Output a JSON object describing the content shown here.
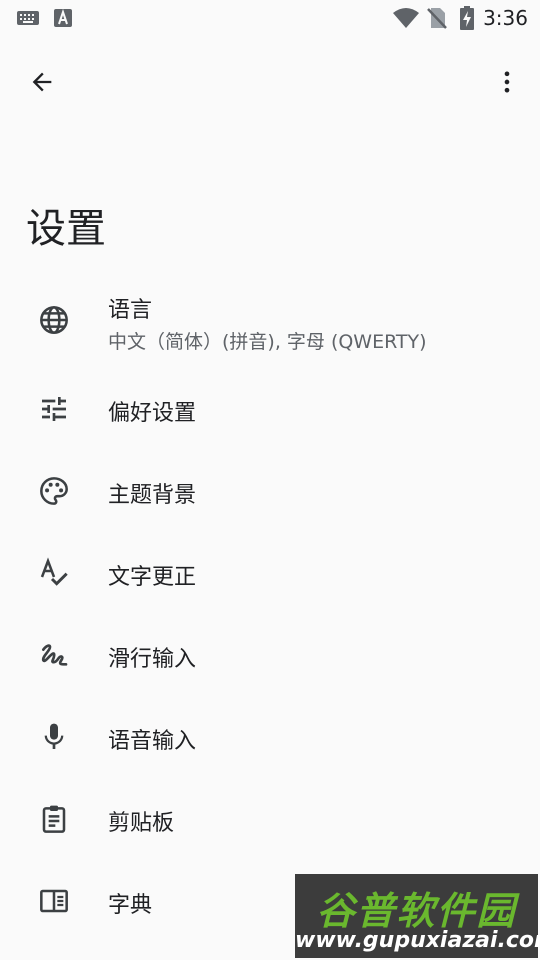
{
  "status_bar": {
    "time": "3:36",
    "icons": [
      "keyboard-icon",
      "font-a-icon",
      "wifi-icon",
      "no-sim-icon",
      "battery-charging-icon"
    ]
  },
  "toolbar": {
    "back_icon": "arrow-back-icon",
    "more_icon": "more-vert-icon"
  },
  "page": {
    "title": "设置"
  },
  "menu": [
    {
      "icon": "globe-icon",
      "label": "语言",
      "sub": "中文（简体）(拼音), 字母 (QWERTY)"
    },
    {
      "icon": "tune-icon",
      "label": "偏好设置"
    },
    {
      "icon": "palette-icon",
      "label": "主题背景"
    },
    {
      "icon": "spellcheck-icon",
      "label": "文字更正"
    },
    {
      "icon": "gesture-icon",
      "label": "滑行输入"
    },
    {
      "icon": "mic-icon",
      "label": "语音输入"
    },
    {
      "icon": "clipboard-icon",
      "label": "剪贴板"
    },
    {
      "icon": "dictionary-icon",
      "label": "字典"
    }
  ],
  "watermark": {
    "name": "谷普软件园",
    "url": "www.gupuxiazai.com"
  }
}
